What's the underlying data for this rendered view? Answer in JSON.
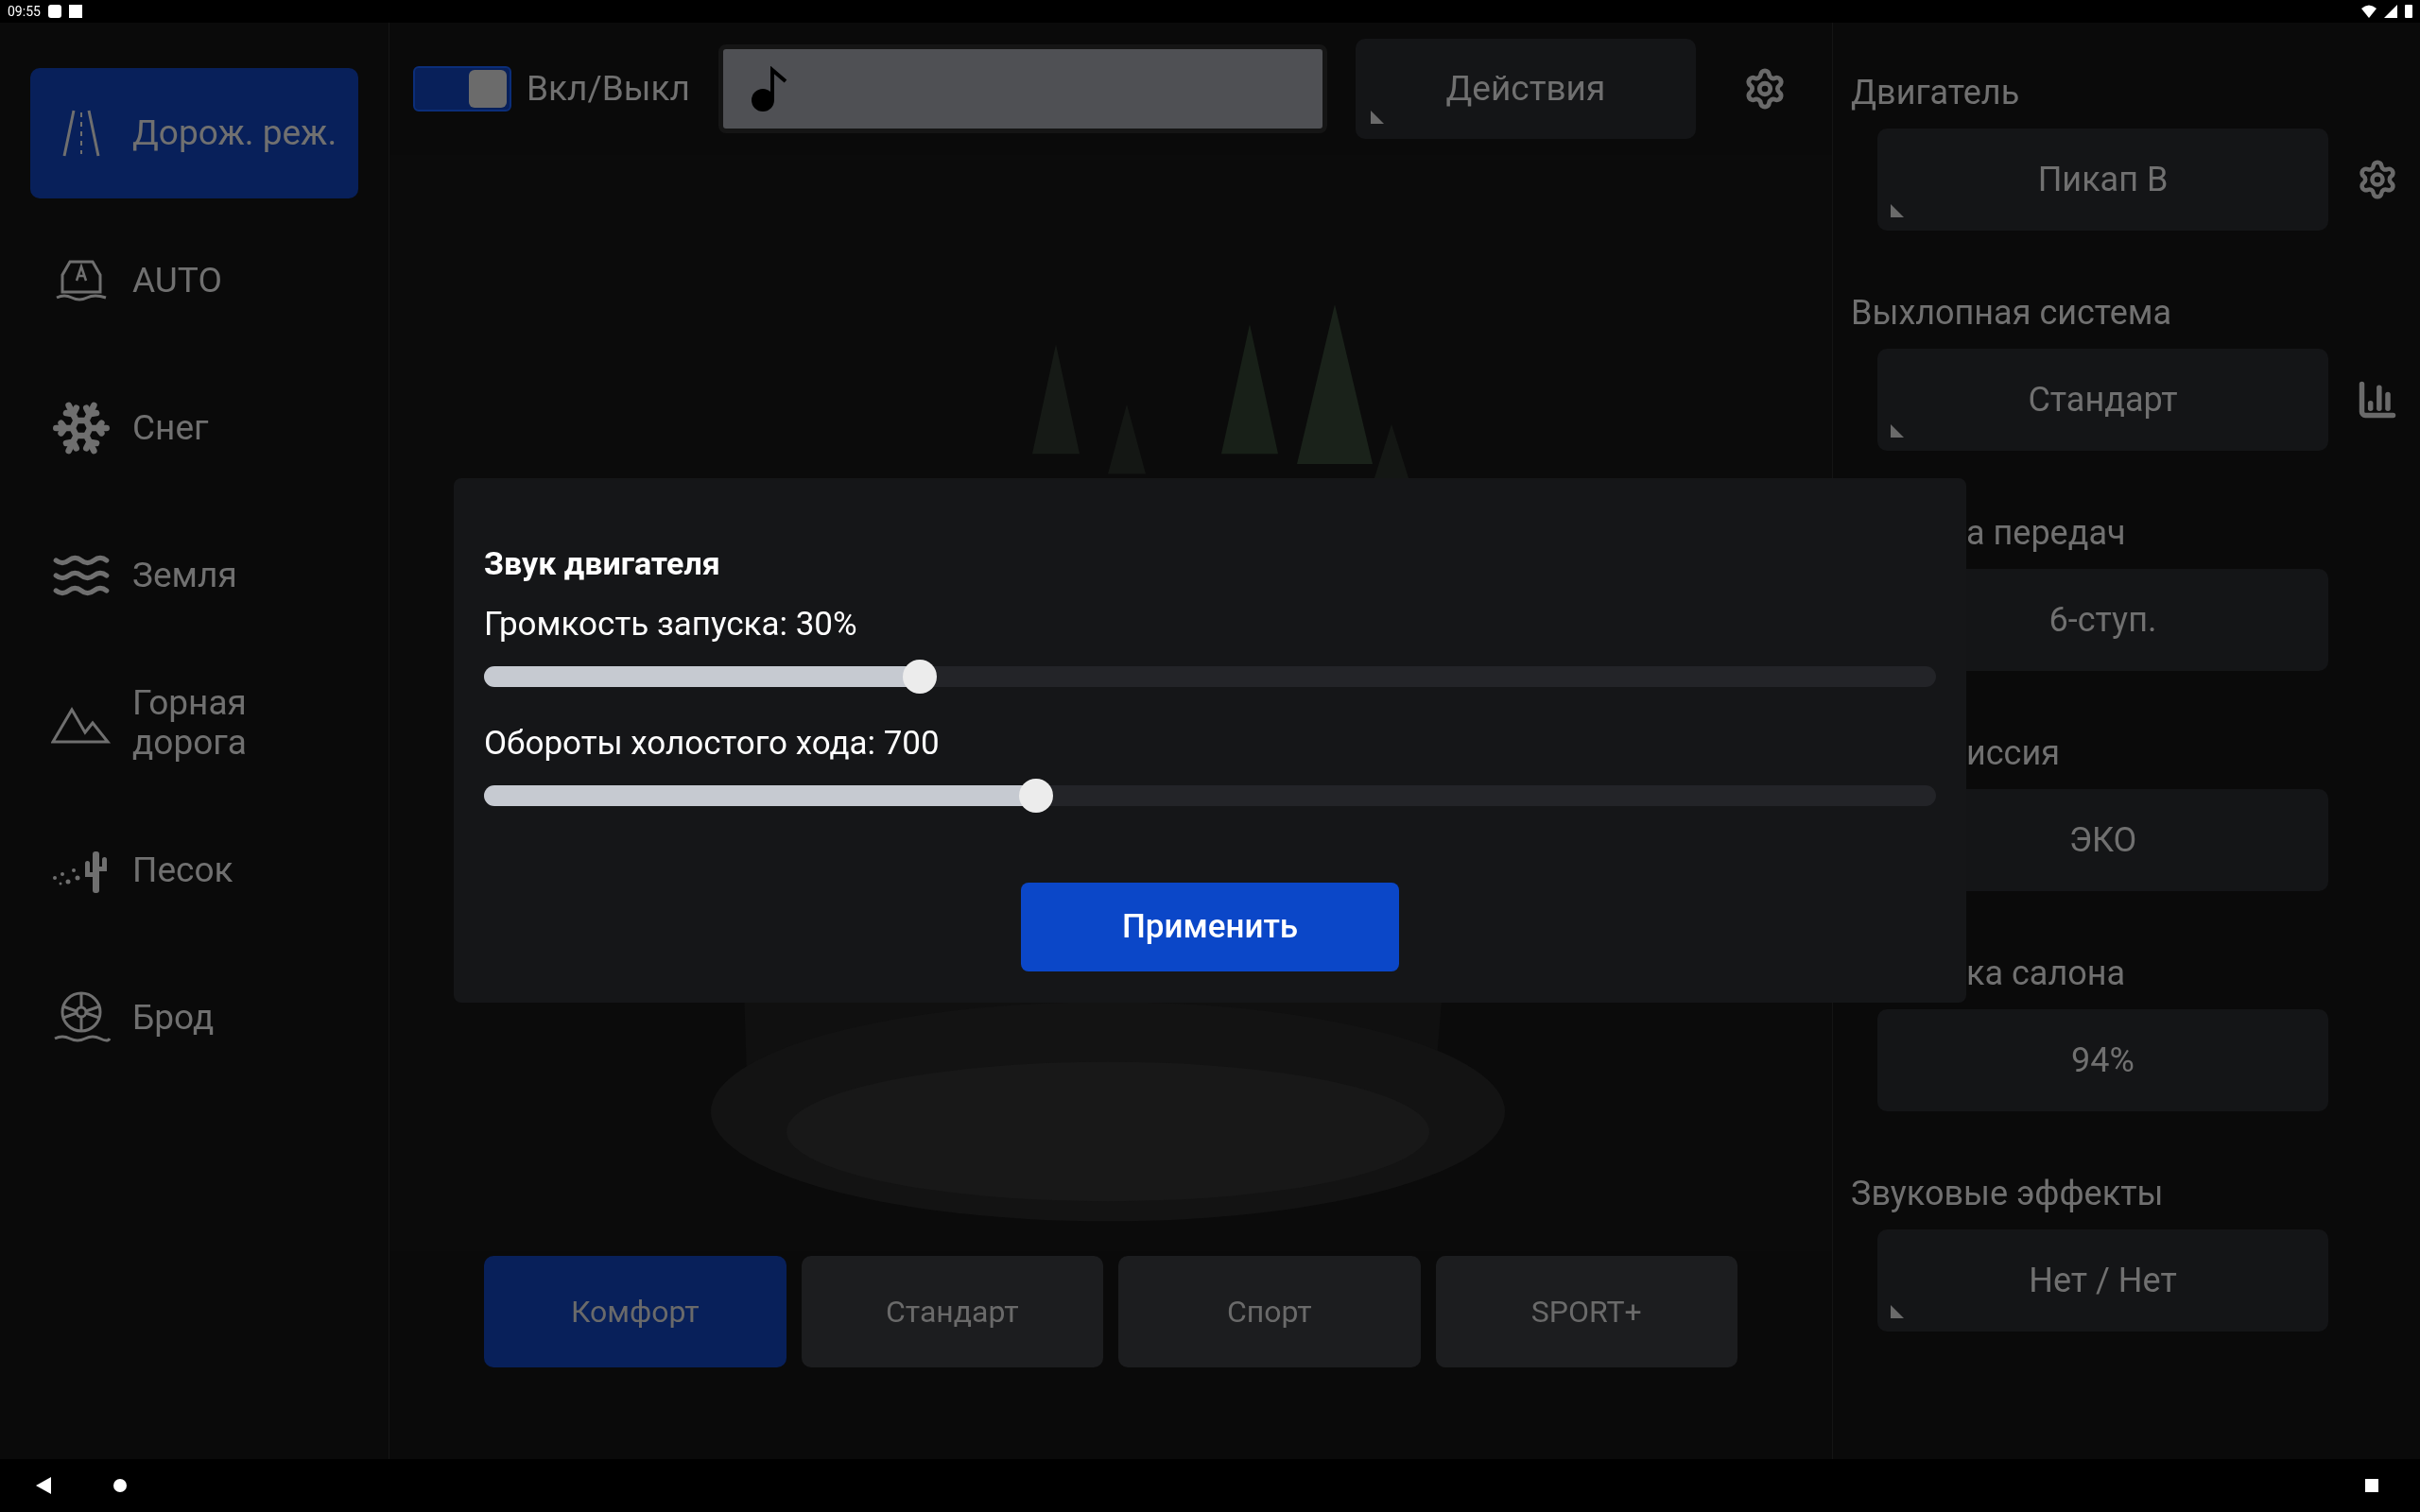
{
  "status_bar": {
    "time": "09:55"
  },
  "sidebar": {
    "items": [
      {
        "kind": "road",
        "label": "Дорож. реж.",
        "selected": true
      },
      {
        "kind": "auto",
        "label": "AUTO",
        "selected": false
      },
      {
        "kind": "snow",
        "label": "Снег",
        "selected": false
      },
      {
        "kind": "ground",
        "label": "Земля",
        "selected": false
      },
      {
        "kind": "mountain",
        "label": "Горная дорога",
        "selected": false
      },
      {
        "kind": "sand",
        "label": "Песок",
        "selected": false
      },
      {
        "kind": "ford",
        "label": "Брод",
        "selected": false
      }
    ]
  },
  "top_bar": {
    "toggle": {
      "label": "Вкл/Выкл",
      "on": true
    },
    "actions_button": "Действия"
  },
  "drive_modes": [
    {
      "label": "Комфорт",
      "selected": true
    },
    {
      "label": "Стандарт",
      "selected": false
    },
    {
      "label": "Спорт",
      "selected": false
    },
    {
      "label": "SPORT+",
      "selected": false
    }
  ],
  "settings": [
    {
      "label": "Двигатель",
      "value": "Пикап B",
      "kind": "with_gear"
    },
    {
      "label": "Выхлопная система",
      "value": "Стандарт",
      "kind": "with_chart"
    },
    {
      "label": "а передач",
      "value": "6-ступ.",
      "kind": "under_dialog"
    },
    {
      "label": "иссия",
      "value": "ЭКО",
      "kind": "under_dialog"
    },
    {
      "label": "ка салона",
      "value": "94%",
      "kind": "under_dialog"
    },
    {
      "label": "Звуковые эффекты",
      "value": "Нет / Нет",
      "kind": "plain"
    }
  ],
  "dialog": {
    "title": "Звук двигателя",
    "sliders": [
      {
        "label": "Громкость запуска: 30%",
        "level": 0.3
      },
      {
        "label": "Обороты холостого хода: 700",
        "level": 0.38
      }
    ],
    "apply_button": "Применить"
  }
}
